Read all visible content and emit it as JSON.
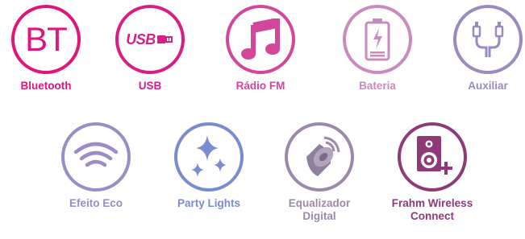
{
  "features": [
    {
      "id": "bluetooth",
      "label": "Bluetooth",
      "icon": "bt-text-icon",
      "icon_text": "BT",
      "color": "#e1147b"
    },
    {
      "id": "usb",
      "label": "USB",
      "icon": "usb-icon",
      "icon_text": "USB",
      "color": "#d81e86"
    },
    {
      "id": "radio-fm",
      "label": "Rádio FM",
      "icon": "music-note-icon",
      "color": "#d2479a"
    },
    {
      "id": "bateria",
      "label": "Bateria",
      "icon": "battery-charging-icon",
      "color": "#c98bbd"
    },
    {
      "id": "auxiliar",
      "label": "Auxiliar",
      "icon": "aux-cable-icon",
      "color": "#9a8ac0"
    },
    {
      "id": "efeito-eco",
      "label": "Efeito Eco",
      "icon": "wifi-echo-icon",
      "color": "#9b8cc6"
    },
    {
      "id": "party-lights",
      "label": "Party Lights",
      "icon": "sparkles-icon",
      "color": "#7b8bd0"
    },
    {
      "id": "equalizador",
      "label": "Equalizador\nDigital",
      "icon": "speaker-cone-icon",
      "color": "#9a8aa8"
    },
    {
      "id": "frahm-wireless",
      "label": "Frahm Wireless\nConnect",
      "icon": "speaker-plus-icon",
      "color": "#8e3a78"
    }
  ]
}
